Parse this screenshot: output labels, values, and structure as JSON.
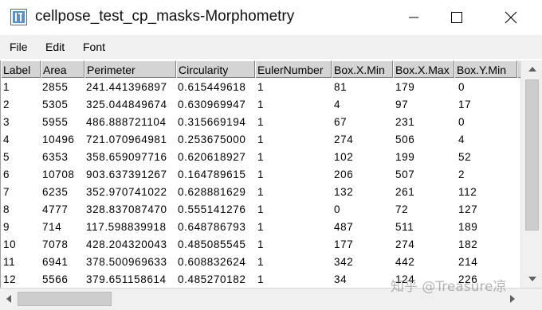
{
  "window": {
    "title": "cellpose_test_cp_masks-Morphometry",
    "icon": "imagej-icon",
    "controls": [
      "minimize-icon",
      "maximize-icon",
      "close-icon"
    ]
  },
  "menu": {
    "file": "File",
    "edit": "Edit",
    "font": "Font"
  },
  "table": {
    "columns": [
      "Label",
      "Area",
      "Perimeter",
      "Circularity",
      "EulerNumber",
      "Box.X.Min",
      "Box.X.Max",
      "Box.Y.Min"
    ],
    "rows": [
      [
        "1",
        "2855",
        "241.441396897",
        "0.615449618",
        "1",
        "81",
        "179",
        "0"
      ],
      [
        "2",
        "5305",
        "325.044849674",
        "0.630969947",
        "1",
        "4",
        "97",
        "17"
      ],
      [
        "3",
        "5955",
        "486.888721104",
        "0.315669194",
        "1",
        "67",
        "231",
        "0"
      ],
      [
        "4",
        "10496",
        "721.070964981",
        "0.253675000",
        "1",
        "274",
        "506",
        "4"
      ],
      [
        "5",
        "6353",
        "358.659097716",
        "0.620618927",
        "1",
        "102",
        "199",
        "52"
      ],
      [
        "6",
        "10708",
        "903.637391267",
        "0.164789615",
        "1",
        "206",
        "507",
        "2"
      ],
      [
        "7",
        "6235",
        "352.970741022",
        "0.628881629",
        "1",
        "132",
        "261",
        "112"
      ],
      [
        "8",
        "4777",
        "328.837087470",
        "0.555141276",
        "1",
        "0",
        "72",
        "127"
      ],
      [
        "9",
        "714",
        "117.598839918",
        "0.648786793",
        "1",
        "487",
        "511",
        "189"
      ],
      [
        "10",
        "7078",
        "428.204320043",
        "0.485085545",
        "1",
        "177",
        "274",
        "182"
      ],
      [
        "11",
        "6941",
        "378.500969633",
        "0.608832624",
        "1",
        "342",
        "442",
        "214"
      ],
      [
        "12",
        "5566",
        "379.651158614",
        "0.485270182",
        "1",
        "34",
        "124",
        "226"
      ]
    ]
  },
  "watermark": "知乎 @Treasure凉"
}
